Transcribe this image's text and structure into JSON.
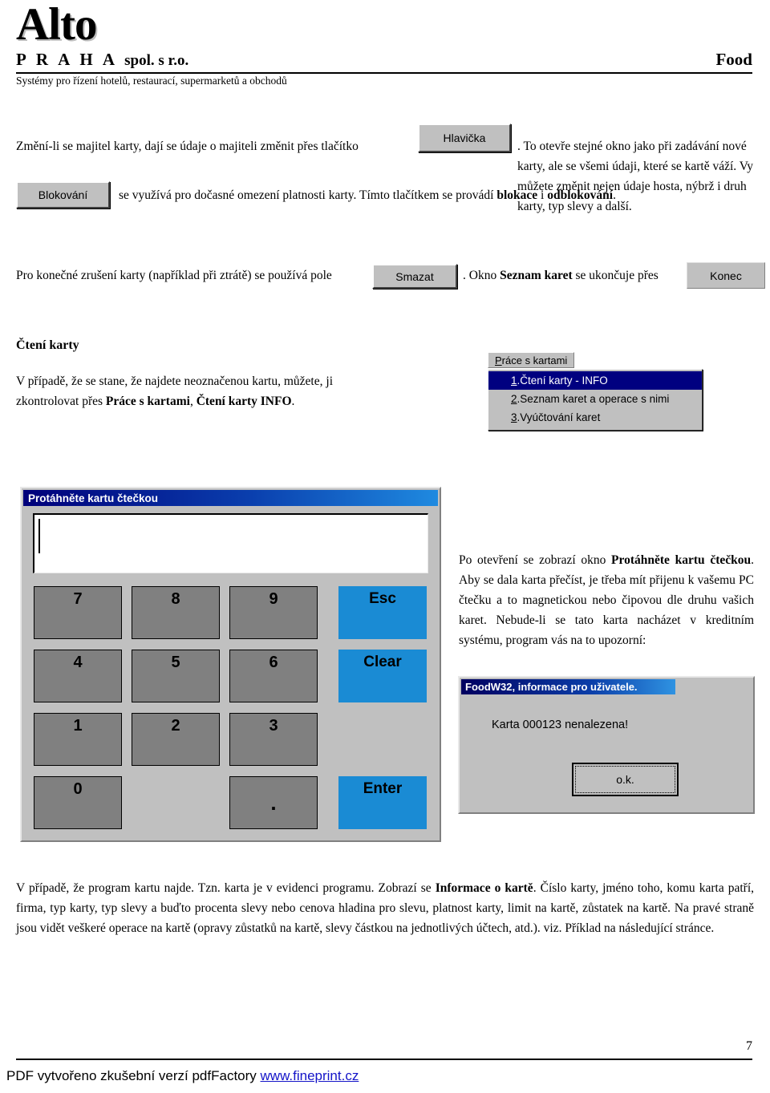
{
  "letterhead": {
    "logo": "Alto",
    "company": "P R A H A",
    "company_suffix": "spol. s r.o.",
    "product": "Food",
    "tagline": "Systémy pro řízení hotelů, restaurací, supermarketů a obchodů"
  },
  "paragraphs": {
    "p1_before": "Změní-li se majitel karty, dají se údaje o majiteli změnit přes tlačítko",
    "p1_after": ". To otevře stejné okno jako při zadávání nové karty, ale se všemi údaji, které se kartě váží. Vy můžete změnit nejen údaje hosta, nýbrž i druh karty, typ slevy a další.",
    "p2_after": "se využívá pro dočasné omezení platnosti karty. Tímto tlačítkem se provádí ",
    "p2_bold1": "blokace",
    "p2_mid": " i ",
    "p2_bold2": "odblokování",
    "p2_end": ".",
    "p3_before": "Pro konečné zrušení karty (například při ztrátě) se používá pole",
    "p3_mid": ". Okno ",
    "p3_bold": "Seznam karet",
    "p3_after": " se ukončuje přes",
    "heading_cteni": "Čtení karty",
    "p4_a": "V případě, že se stane, že najdete neoznačenou kartu, můžete, ji zkontrolovat přes ",
    "p4_b": "Práce s kartami",
    "p4_c": ", ",
    "p4_d": "Čtení karty INFO",
    "p4_e": ".",
    "p5_a": "Po otevření se zobrazí okno ",
    "p5_b": "Protáhněte kartu čtečkou",
    "p5_c": ". Aby se dala karta přečíst, je třeba mít přijenu k vašemu PC čtečku a to magnetickou nebo čipovou dle druhu vašich karet. Nebude-li se tato karta nacházet v kreditním systému, program vás na to upozorní:",
    "p6_a": "V případě, že program kartu najde. Tzn. karta je v evidenci programu. Zobrazí se ",
    "p6_b": "Informace o kartě",
    "p6_c": ". Číslo karty, jméno toho, komu karta patří, firma, typ karty, typ slevy a buďto procenta slevy nebo cenova hladina pro slevu, platnost karty, limit na kartě, zůstatek na kartě. Na pravé straně jsou vidět veškeré operace na kartě (opravy zůstatků na kartě, slevy částkou na jednotlivých účtech, atd.). viz. Příklad na následující stránce."
  },
  "buttons": {
    "hlavicka": "Hlavička",
    "blokovani": "Blokování",
    "smazat": "Smazat",
    "konec": "Konec"
  },
  "menu": {
    "bar_label_ul": "P",
    "bar_label_rest": "ráce s kartami",
    "items": [
      {
        "num": "1",
        "label": ".Čtení karty - INFO",
        "selected": true
      },
      {
        "num": "2",
        "label": ".Seznam karet a operace s nimi",
        "selected": false
      },
      {
        "num": "3",
        "label": ".Vyúčtování karet",
        "selected": false
      }
    ]
  },
  "dialog": {
    "title": "Protáhněte kartu čtečkou",
    "input_value": "",
    "keys": {
      "k7": "7",
      "k8": "8",
      "k9": "9",
      "k4": "4",
      "k5": "5",
      "k6": "6",
      "k1": "1",
      "k2": "2",
      "k3": "3",
      "k0": "0",
      "kdot": ".",
      "esc": "Esc",
      "clear": "Clear",
      "enter": "Enter"
    }
  },
  "msgbox": {
    "title": "FoodW32, informace pro uživatele.",
    "message": "Karta 000123 nenalezena!",
    "ok_label": "o.k."
  },
  "footer": {
    "page_number": "7",
    "pdf_note": "PDF vytvořeno zkušební verzí pdfFactory ",
    "pdf_link": "www.fineprint.cz"
  },
  "colors": {
    "title_bar_dark": "#00007a",
    "title_bar_light": "#1f8ae0",
    "menu_selected": "#000080",
    "key_blue": "#1a8bd4",
    "key_gray": "#808080",
    "face": "#c0c0c0",
    "link": "#1414c8"
  }
}
